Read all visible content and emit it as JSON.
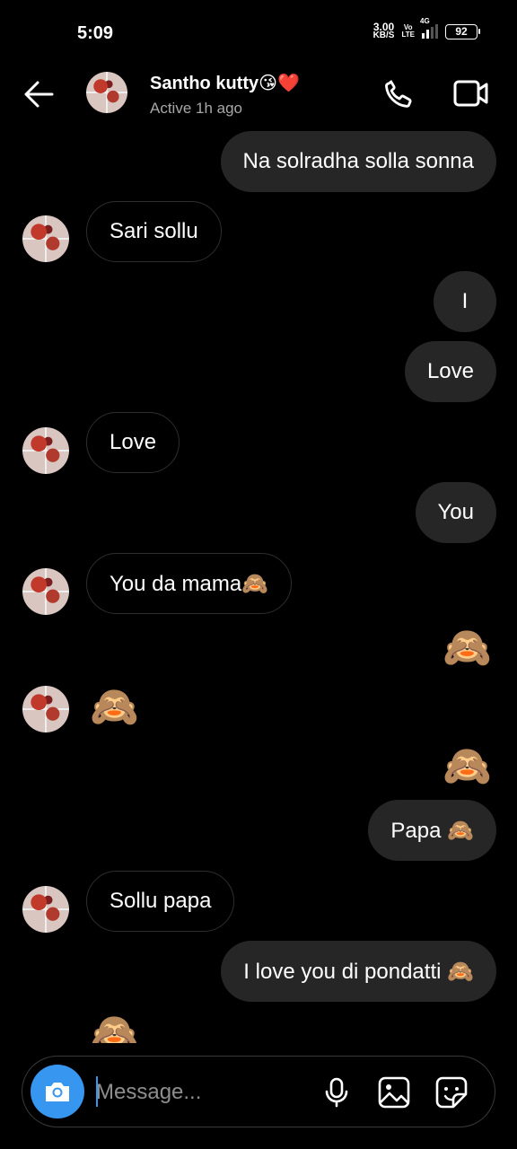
{
  "status_bar": {
    "time": "5:09",
    "net_speed_value": "3.00",
    "net_speed_unit": "KB/S",
    "volte_top": "Vo",
    "volte_bottom": "LTE",
    "network": "4G",
    "battery": "92"
  },
  "header": {
    "contact_name": "Santho kutty😘❤️",
    "status": "Active 1h ago",
    "icons": [
      "back-arrow-icon",
      "phone-icon",
      "video-camera-icon"
    ]
  },
  "messages": [
    {
      "side": "out",
      "text": "Na solradha solla sonna"
    },
    {
      "side": "in",
      "text": "Sari sollu"
    },
    {
      "side": "out",
      "text": "I"
    },
    {
      "side": "out",
      "text": "Love"
    },
    {
      "side": "in",
      "text": "Love"
    },
    {
      "side": "out",
      "text": "You"
    },
    {
      "side": "in",
      "text": "You da mama🙈"
    },
    {
      "side": "out",
      "text": "🙈"
    },
    {
      "side": "in",
      "text": "🙈"
    },
    {
      "side": "out",
      "text": "🙈"
    },
    {
      "side": "out",
      "text": "Papa 🙈"
    },
    {
      "side": "in",
      "text": "Sollu papa"
    },
    {
      "side": "out",
      "text": "I love you di pondatti 🙈"
    },
    {
      "side": "in",
      "text": "🙈"
    }
  ],
  "composer": {
    "placeholder": "Message...",
    "icons": [
      "camera-icon",
      "microphone-icon",
      "gallery-icon",
      "sticker-icon"
    ],
    "camera_button_color": "#3797f0"
  },
  "colors": {
    "background": "#000000",
    "outgoing_bubble": "#262626",
    "incoming_bubble_border": "#2e2e2e",
    "secondary_text": "#a8a8a8"
  }
}
